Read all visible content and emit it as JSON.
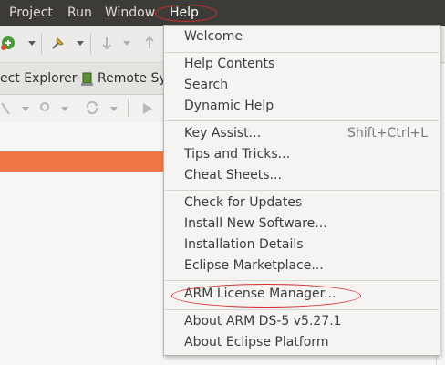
{
  "menubar": {
    "items": [
      {
        "label": "Project"
      },
      {
        "label": "Run"
      },
      {
        "label": "Window"
      },
      {
        "label": "Help"
      }
    ]
  },
  "tabs": {
    "project_explorer": "ect Explorer",
    "remote_systems": "Remote Sys"
  },
  "help_menu": {
    "groups": [
      [
        {
          "label": "Welcome"
        }
      ],
      [
        {
          "label": "Help Contents"
        },
        {
          "label": "Search"
        },
        {
          "label": "Dynamic Help"
        }
      ],
      [
        {
          "label": "Key Assist...",
          "shortcut": "Shift+Ctrl+L"
        },
        {
          "label": "Tips and Tricks..."
        },
        {
          "label": "Cheat Sheets..."
        }
      ],
      [
        {
          "label": "Check for Updates"
        },
        {
          "label": "Install New Software..."
        },
        {
          "label": "Installation Details"
        },
        {
          "label": "Eclipse Marketplace..."
        }
      ],
      [
        {
          "label": "ARM License Manager..."
        }
      ],
      [
        {
          "label": "About ARM DS-5 v5.27.1"
        },
        {
          "label": "About Eclipse Platform"
        }
      ]
    ]
  },
  "colors": {
    "menubar_bg": "#3c3b37",
    "annotation": "#d62d2d",
    "selection_bar": "#f07746"
  }
}
